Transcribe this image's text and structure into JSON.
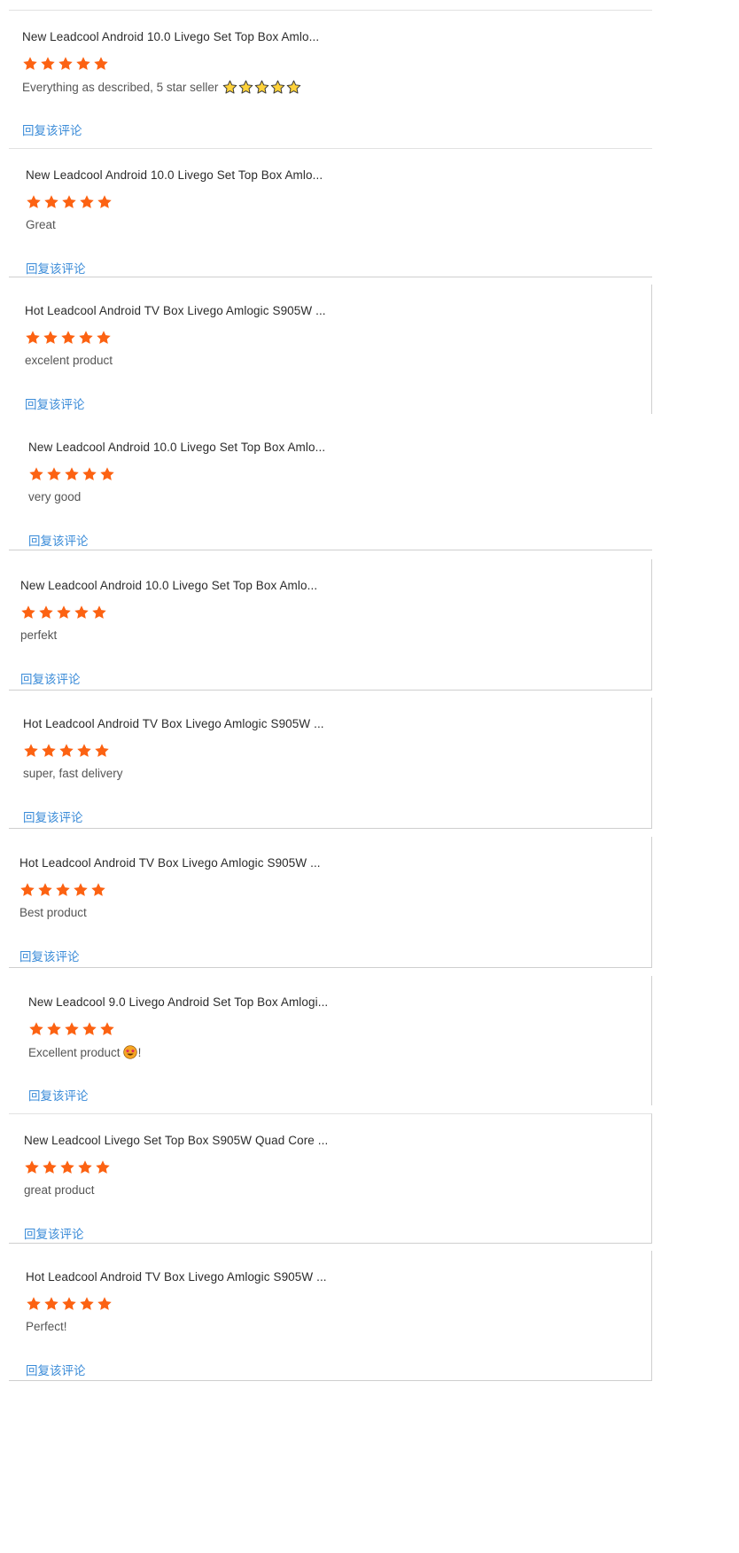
{
  "reviews": [
    {
      "product_title": "New Leadcool Android 10.0 Livego Set Top Box Amlo...",
      "rating": 5,
      "text": "Everything as described, 5 star seller",
      "text_emoji": "star-emoji-x5",
      "reply_label": "回复该评论"
    },
    {
      "product_title": "New Leadcool Android 10.0 Livego Set Top Box Amlo...",
      "rating": 5,
      "text": "Great",
      "reply_label": "回复该评论"
    },
    {
      "product_title": "Hot Leadcool Android TV Box Livego Amlogic S905W ...",
      "rating": 5,
      "text": "excelent product",
      "reply_label": "回复该评论"
    },
    {
      "product_title": "New Leadcool Android 10.0 Livego Set Top Box Amlo...",
      "rating": 5,
      "text": "very good",
      "reply_label": "回复该评论"
    },
    {
      "product_title": "New Leadcool Android 10.0 Livego Set Top Box Amlo...",
      "rating": 5,
      "text": "perfekt",
      "reply_label": "回复该评论"
    },
    {
      "product_title": "Hot Leadcool Android TV Box Livego Amlogic S905W ...",
      "rating": 5,
      "text": "super, fast delivery",
      "reply_label": "回复该评论"
    },
    {
      "product_title": "Hot Leadcool Android TV Box Livego Amlogic S905W ...",
      "rating": 5,
      "text": "Best product",
      "reply_label": "回复该评论"
    },
    {
      "product_title": "New Leadcool 9.0 Livego Android Set Top Box Amlogi...",
      "rating": 5,
      "text": "Excellent product",
      "text_suffix": "!",
      "text_emoji": "star-struck-face-emoji",
      "reply_label": "回复该评论"
    },
    {
      "product_title": "New Leadcool Livego Set Top Box S905W Quad Core ...",
      "rating": 5,
      "text": "great product",
      "reply_label": "回复该评论"
    },
    {
      "product_title": "Hot Leadcool Android TV Box Livego Amlogic S905W ...",
      "rating": 5,
      "text": "Perfect!",
      "reply_label": "回复该评论"
    }
  ],
  "colors": {
    "star": "#fc6212",
    "link": "#3a8bd8",
    "title": "#2b2b2b",
    "text": "#555555",
    "border": "#cfcfcf"
  }
}
